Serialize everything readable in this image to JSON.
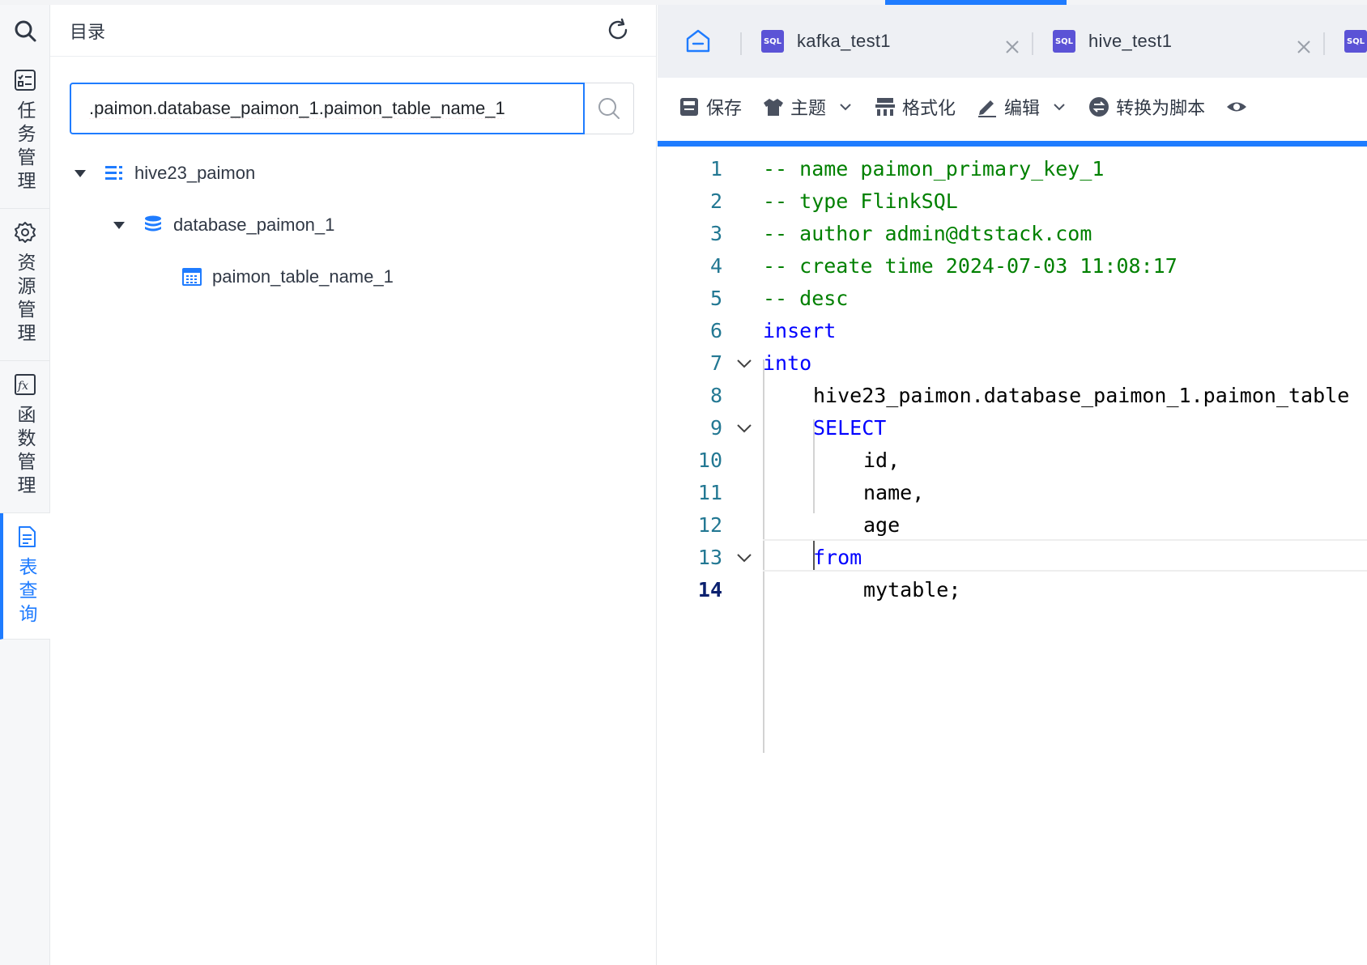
{
  "activity_bar": {
    "items": [
      {
        "label": "任务管理",
        "icon": "task-list-icon"
      },
      {
        "label": "资源管理",
        "icon": "gear-icon"
      },
      {
        "label": "函数管理",
        "icon": "function-icon"
      },
      {
        "label": "表查询",
        "icon": "document-icon"
      }
    ],
    "active_color": "#1f7cff"
  },
  "explorer": {
    "title": "目录",
    "search_value": ".paimon.database_paimon_1.paimon_table_name_1",
    "tree": [
      {
        "label": "hive23_paimon",
        "icon": "catalog-icon",
        "expanded": true
      },
      {
        "label": "database_paimon_1",
        "icon": "database-icon",
        "expanded": true
      },
      {
        "label": "paimon_table_name_1",
        "icon": "table-icon"
      }
    ]
  },
  "tabs": [
    {
      "badge": "SQL",
      "label": "kafka_test1"
    },
    {
      "badge": "SQL",
      "label": "hive_test1"
    },
    {
      "badge": "SQL",
      "label": ""
    }
  ],
  "toolbar": {
    "save": "保存",
    "theme": "主题",
    "format": "格式化",
    "edit": "编辑",
    "convert": "转换为脚本"
  },
  "code": {
    "lines": [
      {
        "n": "1",
        "text": "-- name paimon_primary_key_1",
        "type": "comment"
      },
      {
        "n": "2",
        "text": "-- type FlinkSQL",
        "type": "comment"
      },
      {
        "n": "3",
        "text": "-- author admin@dtstack.com",
        "type": "comment"
      },
      {
        "n": "4",
        "text": "-- create time 2024-07-03 11:08:17",
        "type": "comment"
      },
      {
        "n": "5",
        "text": "-- desc",
        "type": "comment"
      },
      {
        "n": "6",
        "text": "insert",
        "type": "keyword"
      },
      {
        "n": "7",
        "text": "into",
        "type": "keyword"
      },
      {
        "n": "8",
        "text": "hive23_paimon.database_paimon_1.paimon_table",
        "type": "plain"
      },
      {
        "n": "9",
        "text": "SELECT",
        "type": "keyword"
      },
      {
        "n": "10",
        "text": "id,",
        "type": "plain"
      },
      {
        "n": "11",
        "text": "name,",
        "type": "plain"
      },
      {
        "n": "12",
        "text": "age",
        "type": "plain"
      },
      {
        "n": "13",
        "text": "from",
        "type": "keyword"
      },
      {
        "n": "14",
        "text": "mytable;",
        "type": "plain"
      }
    ]
  }
}
